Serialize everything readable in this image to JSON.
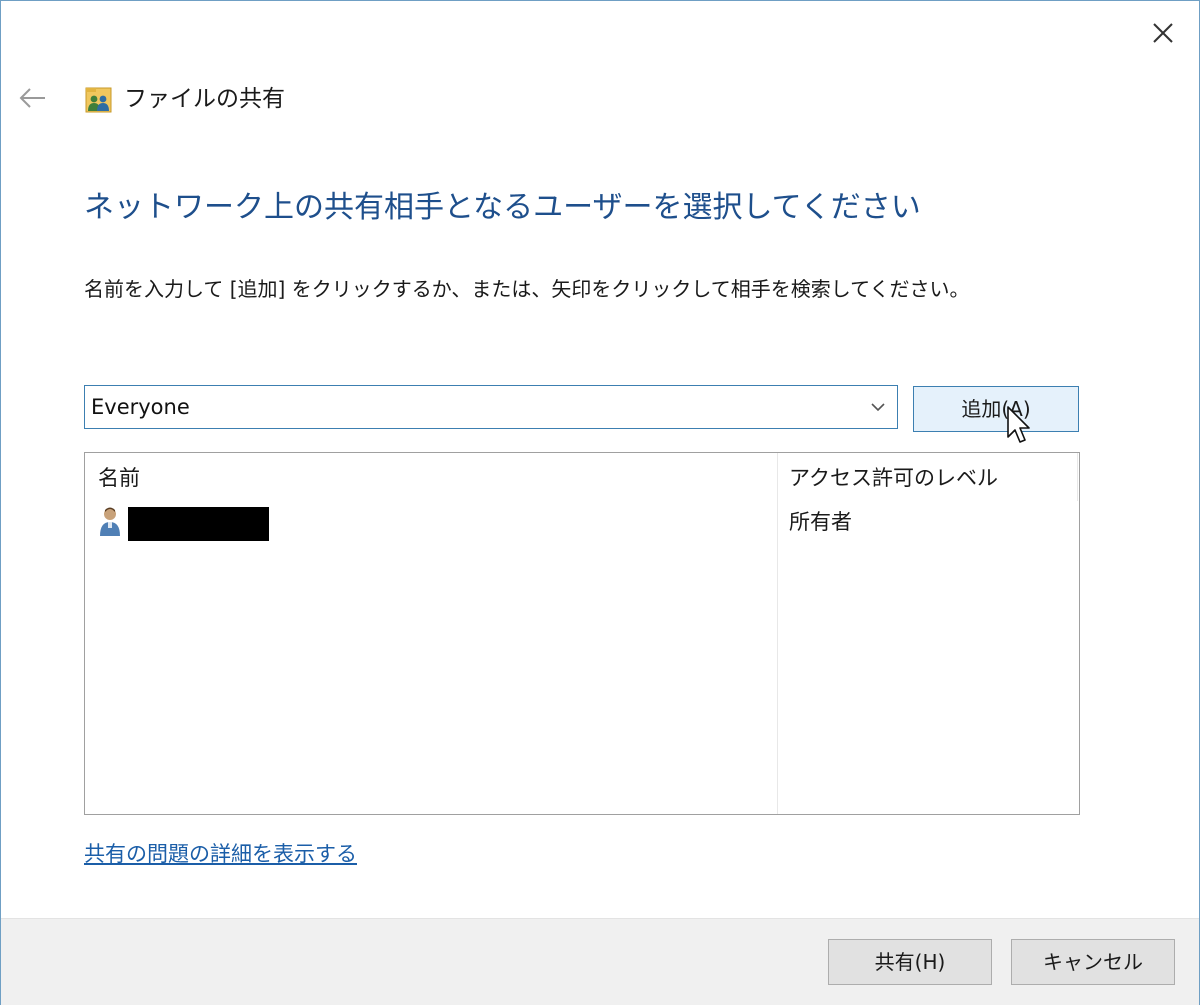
{
  "window": {
    "title": "ファイルの共有",
    "close_icon": "close-icon",
    "back_icon": "back-arrow-icon",
    "title_icon": "users-folder-icon"
  },
  "main": {
    "heading": "ネットワーク上の共有相手となるユーザーを選択してください",
    "instructions": "名前を入力して [追加] をクリックするか、または、矢印をクリックして相手を検索してください。",
    "user_combo": {
      "value": "Everyone"
    },
    "add_button_label": "追加(A)",
    "list": {
      "columns": [
        "名前",
        "アクセス許可のレベル"
      ],
      "rows": [
        {
          "name": "",
          "access": "所有者"
        }
      ]
    },
    "help_link": "共有の問題の詳細を表示する"
  },
  "footer": {
    "share_label": "共有(H)",
    "cancel_label": "キャンセル"
  },
  "colors": {
    "heading": "#1e4f8c",
    "link": "#1b5ea8",
    "focus_border": "#3c7fb1",
    "button_hover_bg": "#e5f1fb",
    "footer_bg": "#f0f0f0"
  }
}
